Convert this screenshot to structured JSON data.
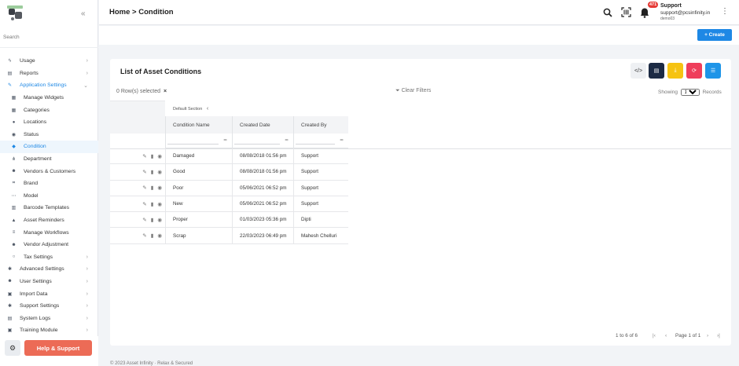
{
  "sidebar": {
    "search_placeholder": "Search",
    "items": [
      {
        "label": "Usage",
        "icon": "bolt-icon",
        "chevron": "›",
        "sub": false,
        "state": ""
      },
      {
        "label": "Reports",
        "icon": "report-icon",
        "chevron": "›",
        "sub": false,
        "state": ""
      },
      {
        "label": "Application Settings",
        "icon": "wrench-icon",
        "chevron": "⌄",
        "sub": false,
        "state": "open"
      },
      {
        "label": "Manage Widgets",
        "icon": "widgets-icon",
        "chevron": "",
        "sub": true,
        "state": ""
      },
      {
        "label": "Categories",
        "icon": "grid-icon",
        "chevron": "",
        "sub": true,
        "state": ""
      },
      {
        "label": "Locations",
        "icon": "location-pin-icon",
        "chevron": "",
        "sub": true,
        "state": ""
      },
      {
        "label": "Status",
        "icon": "status-icon",
        "chevron": "",
        "sub": true,
        "state": ""
      },
      {
        "label": "Condition",
        "icon": "condition-icon",
        "chevron": "",
        "sub": true,
        "state": "active"
      },
      {
        "label": "Department",
        "icon": "sitemap-icon",
        "chevron": "",
        "sub": true,
        "state": ""
      },
      {
        "label": "Vendors & Customers",
        "icon": "users-icon",
        "chevron": "",
        "sub": true,
        "state": ""
      },
      {
        "label": "Brand",
        "icon": "crop-icon",
        "chevron": "",
        "sub": true,
        "state": ""
      },
      {
        "label": "Model",
        "icon": "dots-icon",
        "chevron": "",
        "sub": true,
        "state": ""
      },
      {
        "label": "Barcode Templates",
        "icon": "barcode-icon",
        "chevron": "",
        "sub": true,
        "state": ""
      },
      {
        "label": "Asset Reminders",
        "icon": "bell-icon",
        "chevron": "",
        "sub": true,
        "state": ""
      },
      {
        "label": "Manage Workflows",
        "icon": "workflow-icon",
        "chevron": "",
        "sub": true,
        "state": ""
      },
      {
        "label": "Vendor Adjustment",
        "icon": "user-adjust-icon",
        "chevron": "",
        "sub": true,
        "state": ""
      },
      {
        "label": "Tax Settings",
        "icon": "search-icon",
        "chevron": "›",
        "sub": true,
        "state": ""
      },
      {
        "label": "Advanced Settings",
        "icon": "cogs-icon",
        "chevron": "›",
        "sub": false,
        "state": ""
      },
      {
        "label": "User Settings",
        "icon": "user-cog-icon",
        "chevron": "›",
        "sub": false,
        "state": ""
      },
      {
        "label": "Import Data",
        "icon": "import-icon",
        "chevron": "›",
        "sub": false,
        "state": ""
      },
      {
        "label": "Support Settings",
        "icon": "cogs-icon",
        "chevron": "›",
        "sub": false,
        "state": ""
      },
      {
        "label": "System Logs",
        "icon": "logs-icon",
        "chevron": "›",
        "sub": false,
        "state": ""
      },
      {
        "label": "Training Module",
        "icon": "training-icon",
        "chevron": "›",
        "sub": false,
        "state": ""
      }
    ],
    "help_label": "Help & Support"
  },
  "header": {
    "breadcrumb_home": "Home",
    "breadcrumb_sep": ">",
    "breadcrumb_current": "Condition",
    "notification_count": "471",
    "user_name": "Support",
    "user_email": "support@pcsinfinity.in",
    "user_org": "demo03"
  },
  "subbar": {
    "create_label": "+ Create"
  },
  "card": {
    "title": "List of Asset Conditions",
    "toolbar": [
      {
        "name": "code-view-button",
        "icon": "code-icon",
        "glyph": "</>",
        "bg": "#eef0f3",
        "fg": "#333333"
      },
      {
        "name": "document-button",
        "icon": "document-icon",
        "glyph": "▤",
        "bg": "#1c2a44",
        "fg": "#ffffff"
      },
      {
        "name": "download-button",
        "icon": "download-icon",
        "glyph": "⤓",
        "bg": "#f6c312",
        "fg": "#ffffff"
      },
      {
        "name": "refresh-button",
        "icon": "refresh-icon",
        "glyph": "⟳",
        "bg": "#ef3e5b",
        "fg": "#ffffff"
      },
      {
        "name": "columns-button",
        "icon": "list-icon",
        "glyph": "☰",
        "bg": "#1e95e8",
        "fg": "#ffffff"
      }
    ],
    "rows_selected": "0 Row(s) selected",
    "clear_filters": "Clear Filters",
    "showing_label": "Showing",
    "page_size": "100",
    "records_label": "Records",
    "group_label": "Default Section",
    "columns": [
      "Condition Name",
      "Created Date",
      "Created By"
    ],
    "rows": [
      [
        "Damaged",
        "08/08/2018 01:56 pm",
        "Support"
      ],
      [
        "Good",
        "08/08/2018 01:56 pm",
        "Support"
      ],
      [
        "Poor",
        "05/06/2021 06:52 pm",
        "Support"
      ],
      [
        "New",
        "05/06/2021 06:52 pm",
        "Support"
      ],
      [
        "Proper",
        "01/03/2023 05:36 pm",
        "Dipti"
      ],
      [
        "Scrap",
        "22/03/2023 06:49 pm",
        "Mahesh Chelluri"
      ]
    ],
    "pager_count": "1 to 6 of 6",
    "pager_text": "Page 1 of 1"
  },
  "footer": {
    "text": "© 2023 Asset Infinity · Relax & Secured"
  }
}
